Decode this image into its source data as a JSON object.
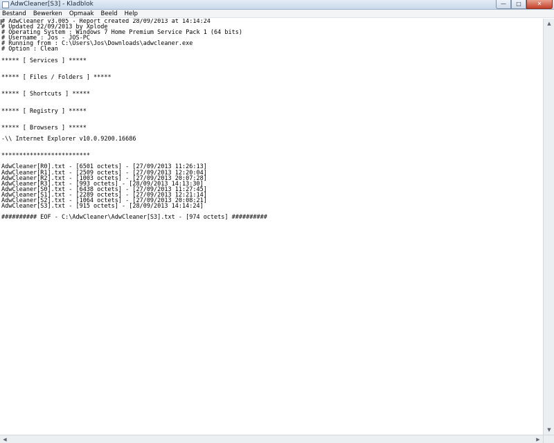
{
  "window": {
    "title": "AdwCleaner[S3] - Kladblok",
    "buttons": {
      "minimize": "—",
      "maximize": "□",
      "close": "✕"
    }
  },
  "menu": [
    "Bestand",
    "Bewerken",
    "Opmaak",
    "Beeld",
    "Help"
  ],
  "document": {
    "lines": [
      "# AdwCleaner v3.005 - Report created 28/09/2013 at 14:14:24",
      "# Updated 22/09/2013 by Xplode",
      "# Operating System : Windows 7 Home Premium Service Pack 1 (64 bits)",
      "# Username : Jos - JOS-PC",
      "# Running from : C:\\Users\\Jos\\Downloads\\adwcleaner.exe",
      "# Option : Clean",
      "",
      "***** [ Services ] *****",
      "",
      "",
      "***** [ Files / Folders ] *****",
      "",
      "",
      "***** [ Shortcuts ] *****",
      "",
      "",
      "***** [ Registry ] *****",
      "",
      "",
      "***** [ Browsers ] *****",
      "",
      "-\\\\ Internet Explorer v10.0.9200.16686",
      "",
      "",
      "*************************",
      "",
      "AdwCleaner[R0].txt - [6501 octets] - [27/09/2013 11:26:13]",
      "AdwCleaner[R1].txt - [2509 octets] - [27/09/2013 12:20:04]",
      "AdwCleaner[R2].txt - [1003 octets] - [27/09/2013 20:07:28]",
      "AdwCleaner[R3].txt - [993 octets] - [28/09/2013 14:13:30]",
      "AdwCleaner[S0].txt - [6438 octets] - [27/09/2013 11:27:45]",
      "AdwCleaner[S1].txt - [2289 octets] - [27/09/2013 12:21:14]",
      "AdwCleaner[S2].txt - [1064 octets] - [27/09/2013 20:08:21]",
      "AdwCleaner[S3].txt - [915 octets] - [28/09/2013 14:14:24]",
      "",
      "########## EOF - C:\\AdwCleaner\\AdwCleaner[S3].txt - [974 octets] ##########"
    ]
  },
  "scrollbars": {
    "up_arrow": "▲",
    "down_arrow": "▼",
    "left_arrow": "◀",
    "right_arrow": "▶"
  }
}
